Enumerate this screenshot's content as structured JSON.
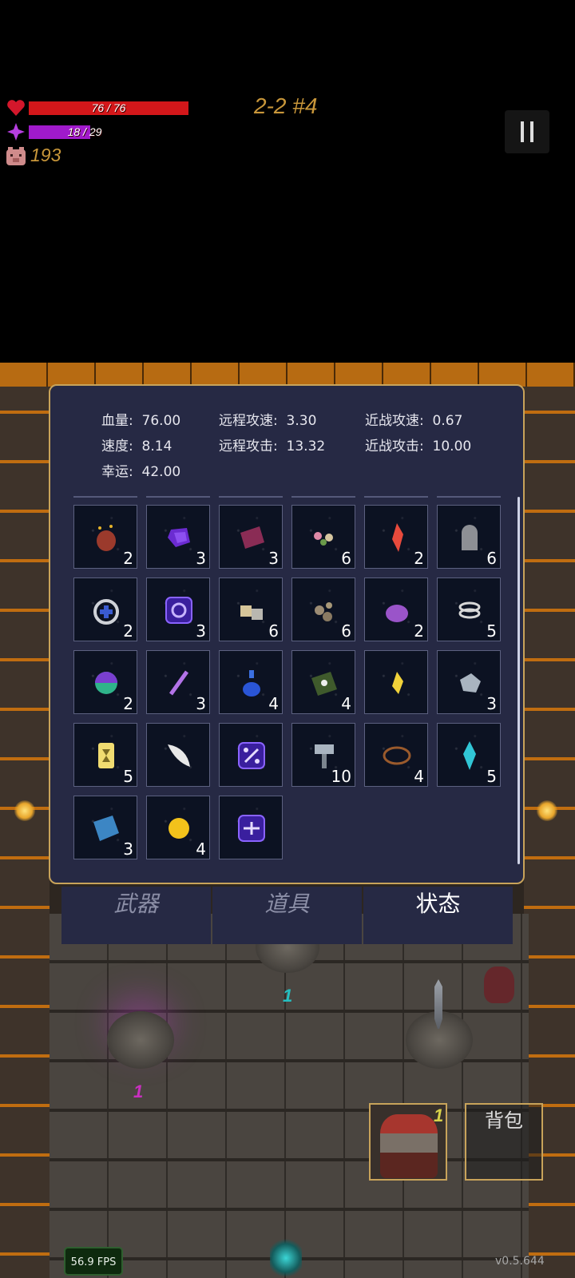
{
  "hud": {
    "hp_text": "76 / 76",
    "hp_fraction": 1.0,
    "mp_text": "18 / 29",
    "mp_fraction": 0.62,
    "coins": "193",
    "stage": "2-2 #4",
    "colors": {
      "hp": "#d3171a",
      "mp": "#a01acb",
      "gold": "#c9973a"
    }
  },
  "stats": {
    "hp_label": "血量:",
    "hp_value": "76.00",
    "speed_label": "速度:",
    "speed_value": "8.14",
    "luck_label": "幸运:",
    "luck_value": "42.00",
    "ranged_speed_label": "远程攻速:",
    "ranged_speed_value": "3.30",
    "ranged_atk_label": "远程攻击:",
    "ranged_atk_value": "13.32",
    "melee_speed_label": "近战攻速:",
    "melee_speed_value": "0.67",
    "melee_atk_label": "近战攻击:",
    "melee_atk_value": "10.00"
  },
  "items": [
    {
      "icon": "red-sack-icon",
      "count": "2"
    },
    {
      "icon": "purple-snail-icon",
      "count": "3"
    },
    {
      "icon": "red-book-icon",
      "count": "3"
    },
    {
      "icon": "flower-bunch-icon",
      "count": "6"
    },
    {
      "icon": "red-crystal-icon",
      "count": "2"
    },
    {
      "icon": "tombstone-icon",
      "count": "6"
    },
    {
      "icon": "medkit-ring-icon",
      "count": "2"
    },
    {
      "icon": "spiral-rune-icon",
      "count": "3"
    },
    {
      "icon": "gold-ore-icon",
      "count": "6"
    },
    {
      "icon": "rocks-icon",
      "count": "6"
    },
    {
      "icon": "purple-slime-icon",
      "count": "2"
    },
    {
      "icon": "silver-rings-icon",
      "count": "5"
    },
    {
      "icon": "rainbow-orb-icon",
      "count": "2"
    },
    {
      "icon": "purple-wand-icon",
      "count": "3"
    },
    {
      "icon": "blue-potion-icon",
      "count": "4"
    },
    {
      "icon": "green-book-icon",
      "count": "4"
    },
    {
      "icon": "yellow-crystal-icon",
      "count": ""
    },
    {
      "icon": "gray-stone-icon",
      "count": "3"
    },
    {
      "icon": "yellow-card-icon",
      "count": "5"
    },
    {
      "icon": "feather-icon",
      "count": ""
    },
    {
      "icon": "percent-rune-icon",
      "count": ""
    },
    {
      "icon": "gray-hammer-icon",
      "count": "10"
    },
    {
      "icon": "thorn-crown-icon",
      "count": "4"
    },
    {
      "icon": "cyan-crystal-icon",
      "count": "5"
    },
    {
      "icon": "blue-book-icon",
      "count": "3"
    },
    {
      "icon": "gold-coin-icon",
      "count": "4"
    },
    {
      "icon": "arrow-rune-icon",
      "count": ""
    }
  ],
  "tabs": {
    "weapons": "武器",
    "items": "道具",
    "status": "状态"
  },
  "floor_numbers": {
    "top": "1",
    "left": "1",
    "avatar": "1"
  },
  "bag_label": "背包",
  "fps": "56.9 FPS",
  "version": "v0.5.644"
}
